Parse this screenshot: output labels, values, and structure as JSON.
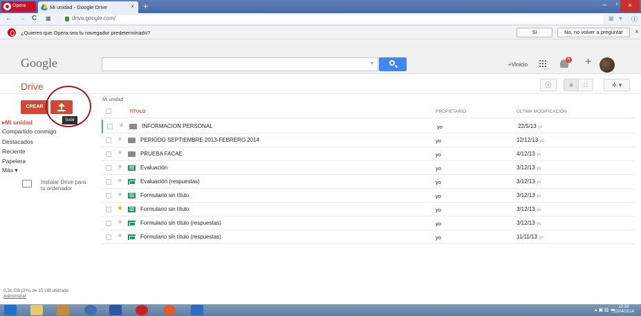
{
  "browser": {
    "opera_label": "Opera",
    "tab_title": "Mi unidad - Google Drive",
    "tab_close": "×",
    "new_tab": "+",
    "url": "drive.google.com/",
    "win_min": "–",
    "win_max": "▫",
    "win_close": "×"
  },
  "notification": {
    "text": "¿Quieres que Opera sea tu navegador predeterminado?",
    "yes_label": "Sí",
    "no_label": "No, no volver a preguntar",
    "close": "×"
  },
  "header": {
    "logo": "Google",
    "vinicio": "+Vinicio",
    "bell_count": "5",
    "plus": "+"
  },
  "drive": {
    "title": "Drive",
    "crear": "CREAR",
    "tooltip": "Subir",
    "info_icon": "ⓘ",
    "list_icon": "≡",
    "grid_icon": "∷",
    "settings_icon": "✲ ▾"
  },
  "sidebar": {
    "items": [
      {
        "label": "Mi unidad",
        "active": true
      },
      {
        "label": "Compartido conmigo"
      },
      {
        "label": "Destacados"
      },
      {
        "label": "Reciente"
      },
      {
        "label": "Papelera"
      },
      {
        "label": "Más ▾"
      }
    ],
    "install": "Instalar Drive para\ntu ordenador",
    "storage": "0,31 GB (2%) de 15 GB utilizado",
    "admin": "Administrar"
  },
  "list": {
    "breadcrumb": "Mi unidad",
    "columns": {
      "title": "TÍTULO",
      "owner": "PROPIETARIO",
      "modified": "ÚLTIMA MODIFICACIÓN"
    },
    "rows": [
      {
        "name": "INFORMACION PERSONAL",
        "type": "folder",
        "owner": "yo",
        "date": "22/5/13",
        "by": "yo",
        "starred": false
      },
      {
        "name": "PERIODO SEPTIEMBRE 2013-FEBRERO 2014",
        "type": "folder",
        "owner": "yo",
        "date": "12/12/13",
        "by": "yo",
        "starred": false
      },
      {
        "name": "PRUEBA FACAE",
        "type": "folder",
        "owner": "yo",
        "date": "4/12/13",
        "by": "yo",
        "starred": false
      },
      {
        "name": "Evaluación",
        "type": "form",
        "owner": "yo",
        "date": "3/12/13",
        "by": "yo",
        "starred": false
      },
      {
        "name": "Evaluación (respuestas)",
        "type": "sheet",
        "owner": "yo",
        "date": "3/12/13",
        "by": "yo",
        "starred": false
      },
      {
        "name": "Formulario sin título",
        "type": "form",
        "owner": "yo",
        "date": "3/12/13",
        "by": "yo",
        "starred": false
      },
      {
        "name": "Formulario sin título",
        "type": "form",
        "owner": "yo",
        "date": "3/12/13",
        "by": "yo",
        "starred": true
      },
      {
        "name": "Formulario sin título (respuestas)",
        "type": "sheet",
        "owner": "yo",
        "date": "3/12/13",
        "by": "yo",
        "starred": false
      },
      {
        "name": "Formulario sin título (respuestas)",
        "type": "sheet",
        "owner": "yo",
        "date": "11/11/13",
        "by": "yo",
        "starred": false
      }
    ]
  },
  "taskbar": {
    "time": "13:33",
    "date": "22/04/2014"
  }
}
